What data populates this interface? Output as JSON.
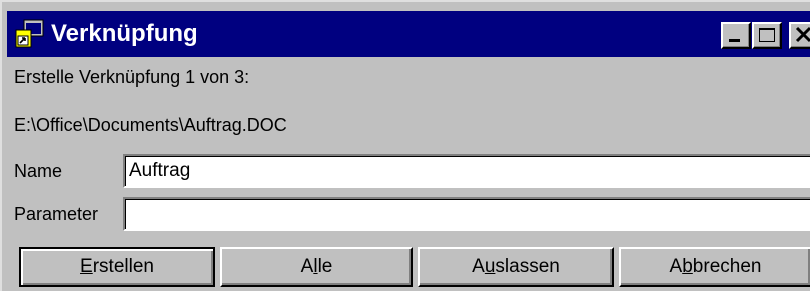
{
  "window": {
    "title": "Verknüpfung",
    "colors": {
      "titlebar": "#000080",
      "face": "#c0c0c0",
      "title_text": "#ffffff"
    },
    "icons": {
      "app": "shortcut-app-icon",
      "minimize": "minimize-icon",
      "maximize": "maximize-icon",
      "close": "close-icon"
    }
  },
  "content": {
    "heading": "Erstelle Verknüpfung 1 von 3:",
    "path": "E:\\Office\\Documents\\Auftrag.DOC"
  },
  "form": {
    "name_label": "Name",
    "name_value": "Auftrag",
    "parameter_label": "Parameter",
    "parameter_value": ""
  },
  "buttons": {
    "erstellen": {
      "before": "",
      "mnemonic": "E",
      "after": "rstellen"
    },
    "alle": {
      "before": "A",
      "mnemonic": "l",
      "after": "le"
    },
    "auslassen": {
      "before": "A",
      "mnemonic": "u",
      "after": "slassen"
    },
    "abbrechen": {
      "before": "A",
      "mnemonic": "b",
      "after": "brechen"
    }
  }
}
